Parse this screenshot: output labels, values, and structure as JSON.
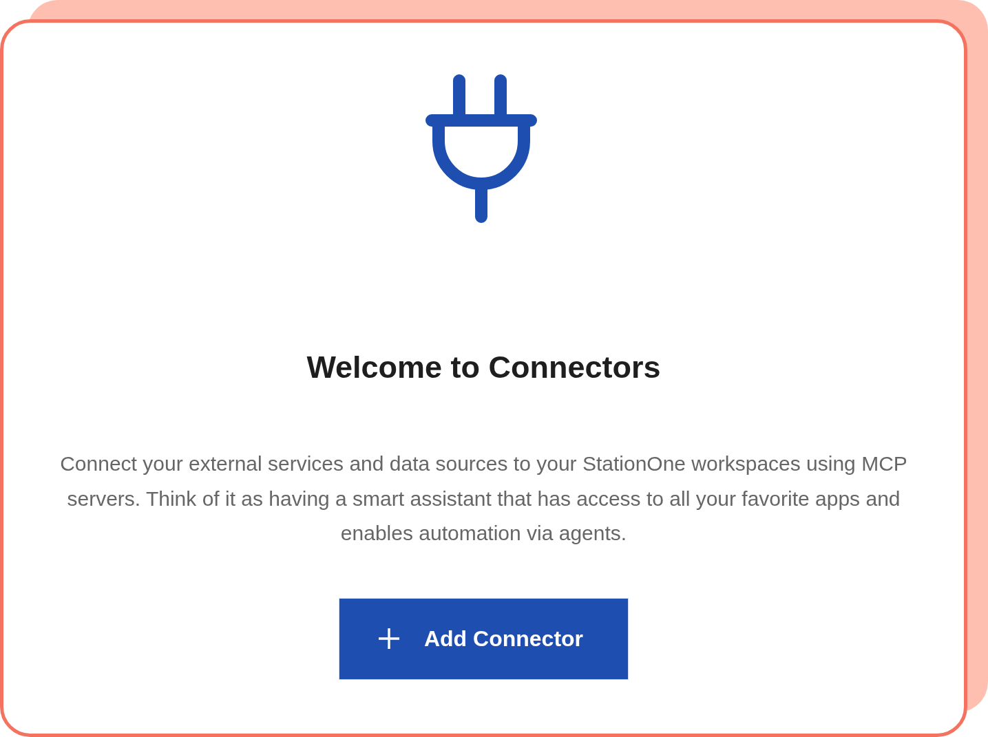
{
  "title": "Welcome to Connectors",
  "description": "Connect your external services and data sources to your StationOne workspaces using MCP servers. Think of it as having a smart assistant that has access to all your favorite apps and enables automation via agents.",
  "button": {
    "label": "Add Connector"
  }
}
